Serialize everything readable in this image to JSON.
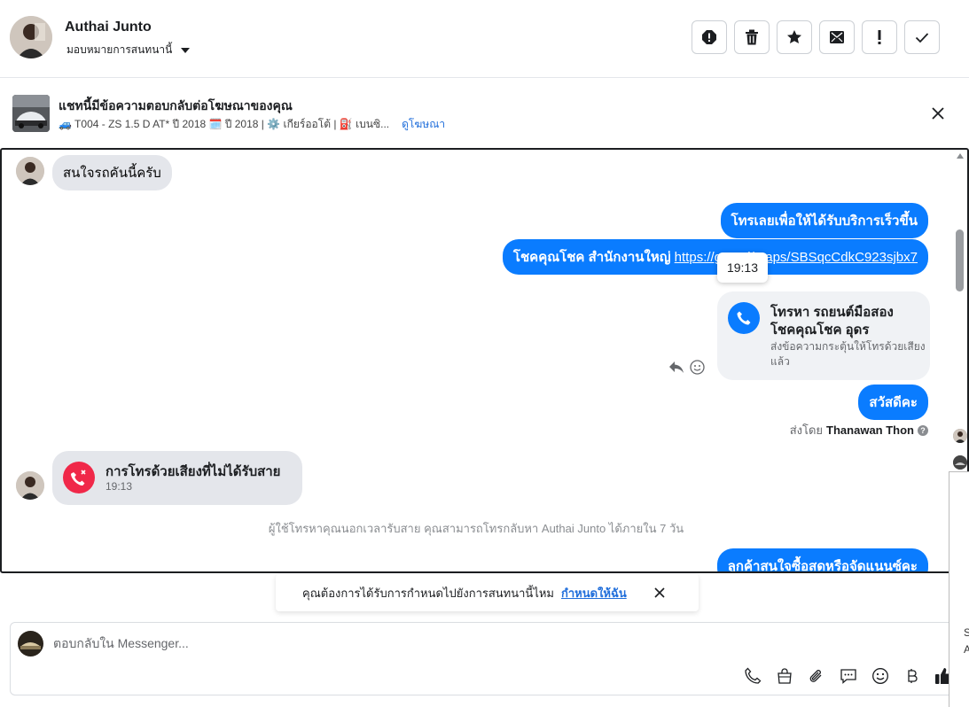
{
  "header": {
    "contact_name": "Authai Junto",
    "assign_label": "มอบหมายการสนทนานี้",
    "toolbar_icons": [
      "spam-icon",
      "trash-icon",
      "star-icon",
      "mark-unread-icon",
      "exclamation-icon",
      "checkmark-icon"
    ]
  },
  "ad": {
    "title": "แชทนี้มีข้อความตอบกลับต่อโฆษณาของคุณ",
    "details": "🚙 T004 - ZS 1.5 D AT* ปี 2018 🗓️ ปี 2018 | ⚙️ เกียร์ออโต้ | ⛽ เบนซิ...",
    "link": "ดูโฆษณา"
  },
  "conversation": {
    "incoming_1": "สนใจรถคันนี้ครับ",
    "outgoing_1": "โทรเลยเพื่อให้ได้รับบริการเร็วขึ้น",
    "outgoing_2_prefix": "โชคคุณโชค สำนักงานใหญ่ ",
    "outgoing_2_link": "https://goo.gl/maps/SBSqcCdkC923sjbx7",
    "tooltip_time": "19:13",
    "call_card": {
      "title": "โทรหา รถยนต์มือสอง โชคคุณโชค อุดร",
      "subtitle": "ส่งข้อความกระตุ้นให้โทรด้วยเสียงแล้ว"
    },
    "outgoing_3": "สวัสดีคะ",
    "sent_by_label": "ส่งโดย",
    "sent_by_name": "Thanawan Thon",
    "missed_call": {
      "title": "การโทรด้วยเสียงที่ไม่ได้รับสาย",
      "time": "19:13"
    },
    "system_note": "ผู้ใช้โทรหาคุณนอกเวลารับสาย คุณสามารถโทรกลับหา Authai Junto ได้ภายใน 7 วัน",
    "outgoing_4": "ลูกค้าสนใจซื้อสดหรือจัดแนนซ์คะ"
  },
  "reminder": {
    "text": "คุณต้องการได้รับการกำหนดไปยังการสนทนานี้ไหม",
    "link": "กำหนดให้ฉัน"
  },
  "composer": {
    "placeholder": "ตอบกลับใน Messenger...",
    "tools": [
      "phone-icon",
      "shopping-bag-icon",
      "paperclip-icon",
      "saved-replies-icon",
      "emoji-icon",
      "baht-icon",
      "thumbs-up-icon"
    ]
  },
  "edge": {
    "letter_1": "S",
    "letter_2": "A"
  },
  "colors": {
    "messenger_blue": "#0a7cff",
    "missed_red": "#f02849",
    "link_blue": "#216fdb",
    "incoming_gray": "#e4e6eb"
  }
}
